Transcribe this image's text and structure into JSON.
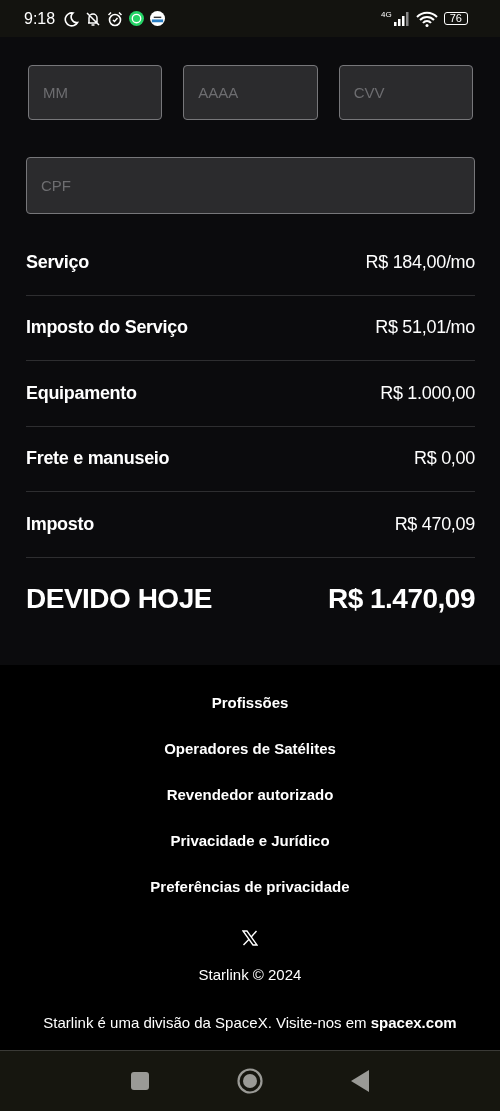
{
  "status_bar": {
    "time": "9:18",
    "network": "4G",
    "battery": "76"
  },
  "card_fields": [
    {
      "placeholder": "MM"
    },
    {
      "placeholder": "AAAA"
    },
    {
      "placeholder": "CVV"
    }
  ],
  "cpf_field": {
    "placeholder": "CPF"
  },
  "summary": [
    {
      "label": "Serviço",
      "value": "R$ 184,00/mo"
    },
    {
      "label": "Imposto do Serviço",
      "value": "R$ 51,01/mo"
    },
    {
      "label": "Equipamento",
      "value": "R$ 1.000,00"
    },
    {
      "label": "Frete e manuseio",
      "value": "R$ 0,00"
    },
    {
      "label": "Imposto",
      "value": "R$ 470,09"
    }
  ],
  "total": {
    "label": "DEVIDO HOJE",
    "value": "R$ 1.470,09"
  },
  "footer": {
    "links": [
      "Profissões",
      "Operadores de Satélites",
      "Revendedor autorizado",
      "Privacidade e Jurídico",
      "Preferências de privacidade"
    ],
    "copyright": "Starlink © 2024",
    "note": {
      "text": "Starlink é uma divisão da SpaceX. Visite-nos em",
      "link": "spacex.com"
    }
  }
}
